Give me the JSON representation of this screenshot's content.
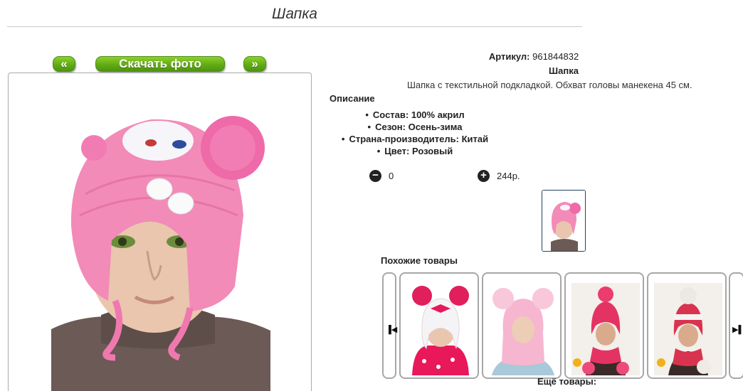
{
  "page": {
    "title": "Шапка"
  },
  "gallery": {
    "prev_label": "«",
    "download_label": "Скачать фото",
    "next_label": "»"
  },
  "product": {
    "article_label": "Артикул:",
    "article_value": "961844832",
    "name": "Шапка",
    "description": "Шапка с текстильной подкладкой. Обхват головы манекена 45 см."
  },
  "specs": {
    "heading": "Описание",
    "items": [
      "Состав: 100% акрил",
      "Сезон: Осень-зима",
      "Страна-производитель: Китай",
      "Цвет: Розовый"
    ]
  },
  "cart": {
    "quantity": "0",
    "price": "244р."
  },
  "icons": {
    "minus": "minus-circle-icon",
    "plus": "plus-circle-icon",
    "carousel_prev": "skip-back-icon",
    "carousel_next": "skip-forward-icon"
  },
  "similar": {
    "heading": "Похожие товары"
  },
  "more": {
    "heading": "Ещё товары:"
  },
  "colors": {
    "button_green": "#62ab14",
    "hat_pink": "#f28bb8",
    "thumb_border": "#25415f"
  }
}
